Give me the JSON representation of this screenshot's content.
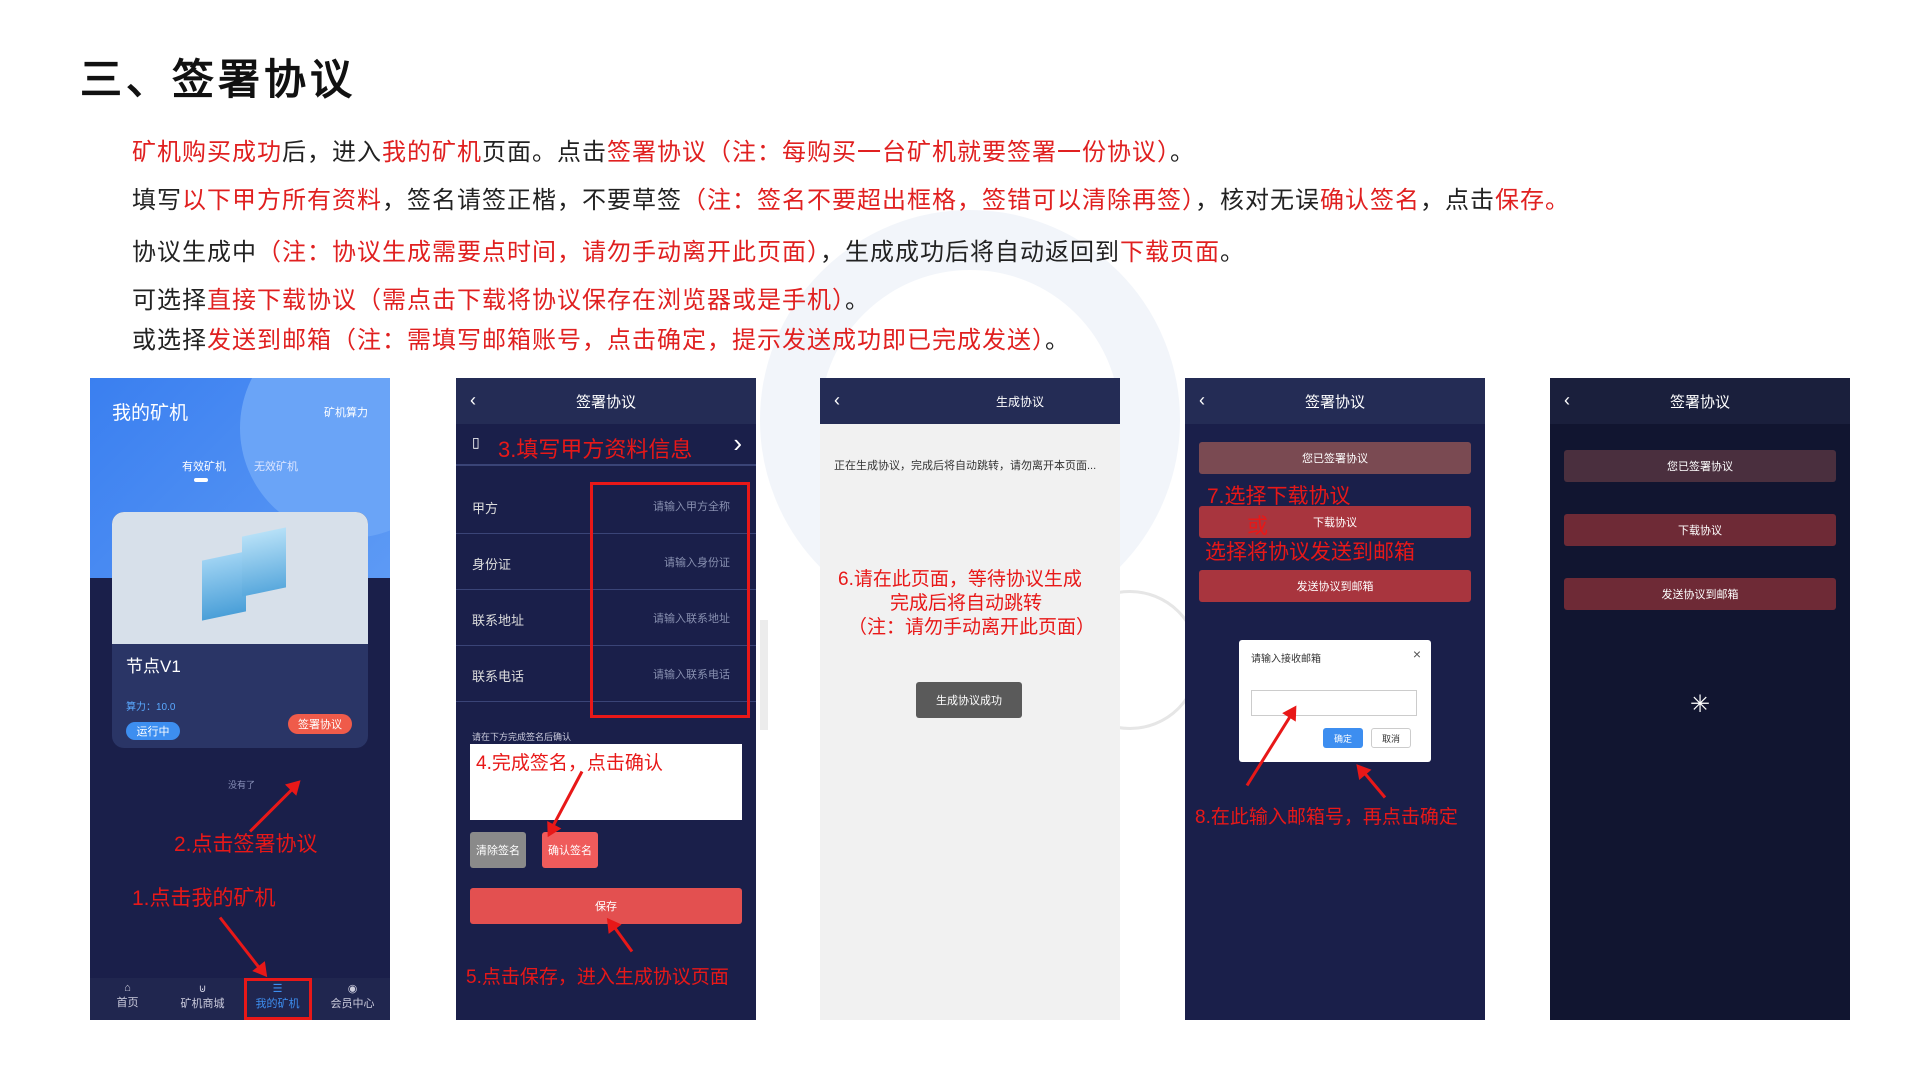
{
  "title": "三、签署协议",
  "lines": [
    [
      {
        "t": "矿机购买成功",
        "r": true
      },
      {
        "t": "后，进入",
        "r": false
      },
      {
        "t": "我的矿机",
        "r": true
      },
      {
        "t": "页面。点击",
        "r": false
      },
      {
        "t": "签署协议（注：每购买一台矿机就要签署一份协议）",
        "r": true
      },
      {
        "t": "。",
        "r": false
      }
    ],
    [
      {
        "t": "填写",
        "r": false
      },
      {
        "t": "以下甲方所有资料",
        "r": true
      },
      {
        "t": "，签名请签正楷，不要草签",
        "r": false
      },
      {
        "t": "（注：签名不要超出框格，签错可以清除再签）",
        "r": true
      },
      {
        "t": "，核对无误",
        "r": false
      },
      {
        "t": "确认签名",
        "r": true
      },
      {
        "t": "，点击",
        "r": false
      },
      {
        "t": "保存。",
        "r": true
      }
    ],
    [
      {
        "t": "协议生成中",
        "r": false
      },
      {
        "t": "（注：协议生成需要点时间，请勿手动离开此页面）",
        "r": true
      },
      {
        "t": "，生成成功后将自动返回到",
        "r": false
      },
      {
        "t": "下载页面",
        "r": true
      },
      {
        "t": "。",
        "r": false
      }
    ],
    [
      {
        "t": "可选择",
        "r": false
      },
      {
        "t": "直接下载协议（需点击下载将协议保存在浏览器或是手机）",
        "r": true
      },
      {
        "t": "。",
        "r": false
      }
    ],
    [
      {
        "t": "或选择",
        "r": false
      },
      {
        "t": "发送到邮箱（注：需填写邮箱账号，点击确定，提示发送成功即已完成发送）",
        "r": true
      },
      {
        "t": "。",
        "r": false
      }
    ]
  ],
  "colors": {
    "red": "#e02020",
    "dark_bg": "#1a1f4a",
    "accent_blue": "#3d7ee8"
  },
  "phone1": {
    "title": "我的矿机",
    "title_right": "矿机算力",
    "tab_active": "有效矿机",
    "tab_inactive": "无效矿机",
    "card_name": "节点V1",
    "power": "算力：10.0",
    "running": "运行中",
    "sign": "签署协议",
    "none": "没有了",
    "nav": [
      "首页",
      "矿机商城",
      "我的矿机",
      "会员中心"
    ],
    "ann1": "1.点击我的矿机",
    "ann2": "2.点击签署协议"
  },
  "phone2": {
    "title": "签署协议",
    "ann3": "3.填写甲方资料信息",
    "fields": [
      {
        "label": "甲方",
        "placeholder": "请输入甲方全称"
      },
      {
        "label": "身份证",
        "placeholder": "请输入身份证"
      },
      {
        "label": "联系地址",
        "placeholder": "请输入联系地址"
      },
      {
        "label": "联系电话",
        "placeholder": "请输入联系电话"
      }
    ],
    "sign_hint": "请在下方完成签名后确认",
    "ann4": "4.完成签名，点击确认",
    "clear": "清除签名",
    "confirm": "确认签名",
    "save": "保存",
    "ann5": "5.点击保存，进入生成协议页面"
  },
  "phone3": {
    "title": "生成协议",
    "msg": "正在生成协议，完成后将自动跳转，请勿离开本页面...",
    "ann6a": "6.请在此页面，等待协议生成",
    "ann6b": "完成后将自动跳转",
    "ann6c": "（注：请勿手动离开此页面）",
    "toast": "生成协议成功"
  },
  "phone4": {
    "title": "签署协议",
    "signed": "您已签署协议",
    "download": "下载协议",
    "send": "发送协议到邮箱",
    "ann7a": "7.选择下载协议",
    "ann7b": "或",
    "ann7c": "选择将协议发送到邮箱",
    "dialog_title": "请输入接收邮箱",
    "ok": "确定",
    "cancel": "取消",
    "ann8": "8.在此输入邮箱号，再点击确定"
  },
  "phone5": {
    "title": "签署协议",
    "signed": "您已签署协议",
    "download": "下载协议",
    "send": "发送协议到邮箱"
  }
}
